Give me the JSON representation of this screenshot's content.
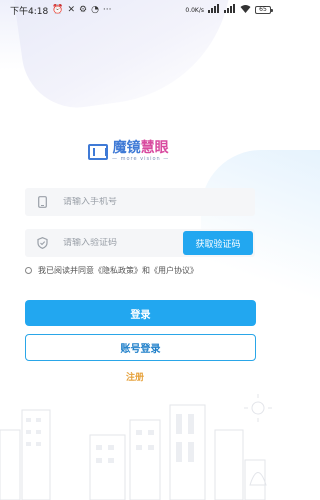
{
  "status_bar": {
    "time": "下午4:18",
    "net_speed": "0.0K/s",
    "battery": "65"
  },
  "logo": {
    "title_blue": "魔镜",
    "title_pink": "慧眼",
    "subtitle": "— more vision —"
  },
  "phone_field": {
    "placeholder": "请输入手机号",
    "value": ""
  },
  "code_field": {
    "placeholder": "请输入验证码",
    "value": ""
  },
  "get_code_label": "获取验证码",
  "agreement": {
    "text": "我已阅读并同意《隐私政策》和《用户协议》"
  },
  "login_label": "登录",
  "account_login_label": "账号登录",
  "register_label": "注册",
  "colors": {
    "primary": "#22a7f0",
    "register": "#e6a23c",
    "logo_blue": "#3f7ad6",
    "logo_pink": "#d84a9f"
  }
}
